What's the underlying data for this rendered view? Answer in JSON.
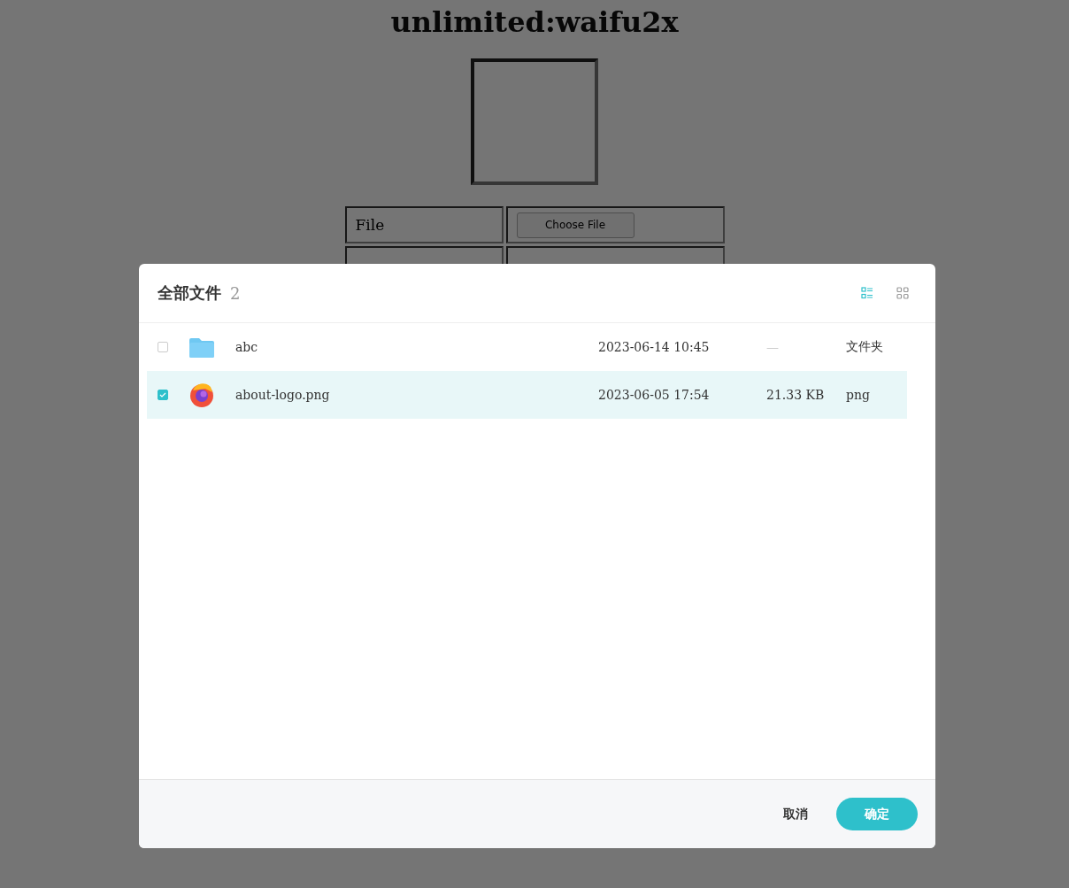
{
  "page": {
    "title": "unlimited:waifu2x",
    "form_rows": [
      {
        "label": "File",
        "button": "Choose File"
      },
      {
        "kind": "covered"
      }
    ]
  },
  "dialog": {
    "title": "全部文件",
    "count": "2",
    "view_modes": [
      {
        "kind": "list",
        "selected": true
      },
      {
        "kind": "grid",
        "selected": false
      }
    ],
    "files": [
      {
        "kind": "folder",
        "name": "abc",
        "modified": "2023-06-14 10:45",
        "size": "—",
        "type": "文件夹",
        "checked": false,
        "selected": false
      },
      {
        "kind": "image",
        "name": "about-logo.png",
        "modified": "2023-06-05 17:54",
        "size": "21.33 KB",
        "type": "png",
        "checked": true,
        "selected": true
      }
    ],
    "buttons": [
      {
        "kind": "secondary",
        "label": "取消"
      },
      {
        "kind": "primary",
        "label": "确定"
      }
    ]
  }
}
